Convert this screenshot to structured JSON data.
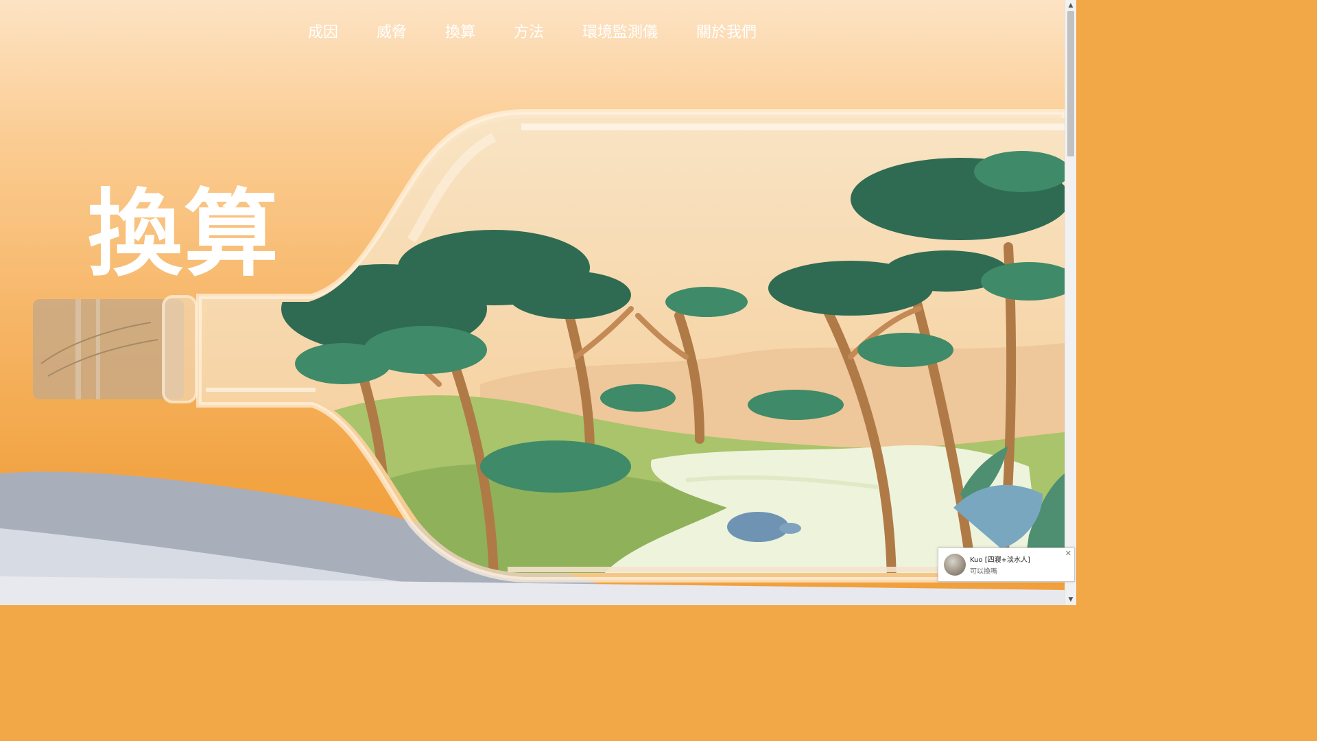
{
  "nav": {
    "items": [
      "成因",
      "威脅",
      "換算",
      "方法",
      "環境監測儀",
      "關於我們"
    ]
  },
  "hero": {
    "title": "換算"
  },
  "chat": {
    "name": "Kuo [四寢+淡水人]",
    "message": "可以換嗎",
    "close_icon": "close-icon"
  },
  "colors": {
    "sky_top": "#fde3c4",
    "sky_bottom": "#f0a03c",
    "tree_dark": "#2f6b52",
    "tree_light": "#3f8a68",
    "ground": "#9fbf5f",
    "river": "#eef3dc"
  }
}
